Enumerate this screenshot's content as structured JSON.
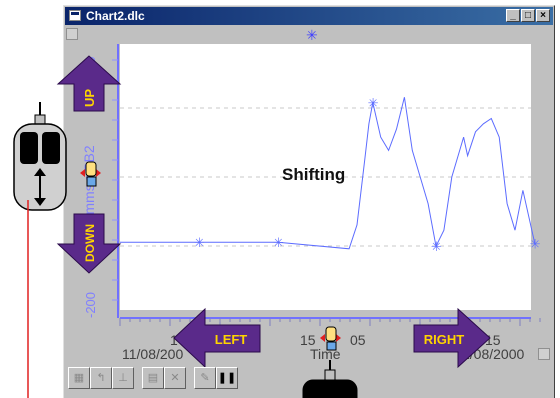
{
  "window": {
    "title": "Chart2.dlc",
    "minimize": "_",
    "maximize": "□",
    "close": "×"
  },
  "chart": {
    "annotation": "Shifting",
    "ylabel": "mms - PB2",
    "y_ticks": [
      "0",
      "0",
      "-200"
    ],
    "xlabel": "Time",
    "x_ticks_left": [
      "1",
      "11/08/200"
    ],
    "x_ticks_mid": [
      "15",
      "05"
    ],
    "x_ticks_right": [
      "15",
      "1/08/2000"
    ]
  },
  "chart_data": {
    "type": "line",
    "title": "",
    "xlabel": "Time",
    "ylabel": "mms - PB2",
    "series": [
      {
        "points": [
          [
            0,
            0.745
          ],
          [
            0.2,
            0.745
          ],
          [
            0.4,
            0.745
          ],
          [
            0.58,
            0.77
          ],
          [
            0.6,
            0.68
          ],
          [
            0.62,
            0.43
          ],
          [
            0.63,
            0.3
          ],
          [
            0.64,
            0.22
          ],
          [
            0.66,
            0.35
          ],
          [
            0.68,
            0.4
          ],
          [
            0.7,
            0.32
          ],
          [
            0.72,
            0.2
          ],
          [
            0.74,
            0.4
          ],
          [
            0.76,
            0.5
          ],
          [
            0.78,
            0.6
          ],
          [
            0.8,
            0.76
          ],
          [
            0.82,
            0.7
          ],
          [
            0.84,
            0.5
          ],
          [
            0.86,
            0.4
          ],
          [
            0.87,
            0.35
          ],
          [
            0.88,
            0.42
          ],
          [
            0.9,
            0.33
          ],
          [
            0.92,
            0.3
          ],
          [
            0.94,
            0.28
          ],
          [
            0.96,
            0.35
          ],
          [
            0.98,
            0.6
          ],
          [
            1.0,
            0.7
          ],
          [
            1.02,
            0.55
          ],
          [
            1.05,
            0.75
          ]
        ],
        "markers": [
          [
            0.2,
            0.745
          ],
          [
            0.4,
            0.745
          ],
          [
            0.64,
            0.22
          ],
          [
            0.8,
            0.76
          ],
          [
            1.05,
            0.75
          ]
        ]
      }
    ],
    "grid": true
  },
  "arrows": {
    "up": "UP",
    "down": "DOWN",
    "left": "LEFT",
    "right": "RIGHT"
  },
  "colors": {
    "arrow": "#5a2a8a",
    "arrow_text": "#ffd400",
    "series": "#5c6cff",
    "axis": "#7070ff",
    "titlebar": "#0a246a"
  },
  "toolbar_icons": [
    "axes-icon",
    "cursor-icon",
    "scale-icon",
    "copy-icon",
    "delete-icon",
    "edit-icon",
    "pause-icon"
  ]
}
